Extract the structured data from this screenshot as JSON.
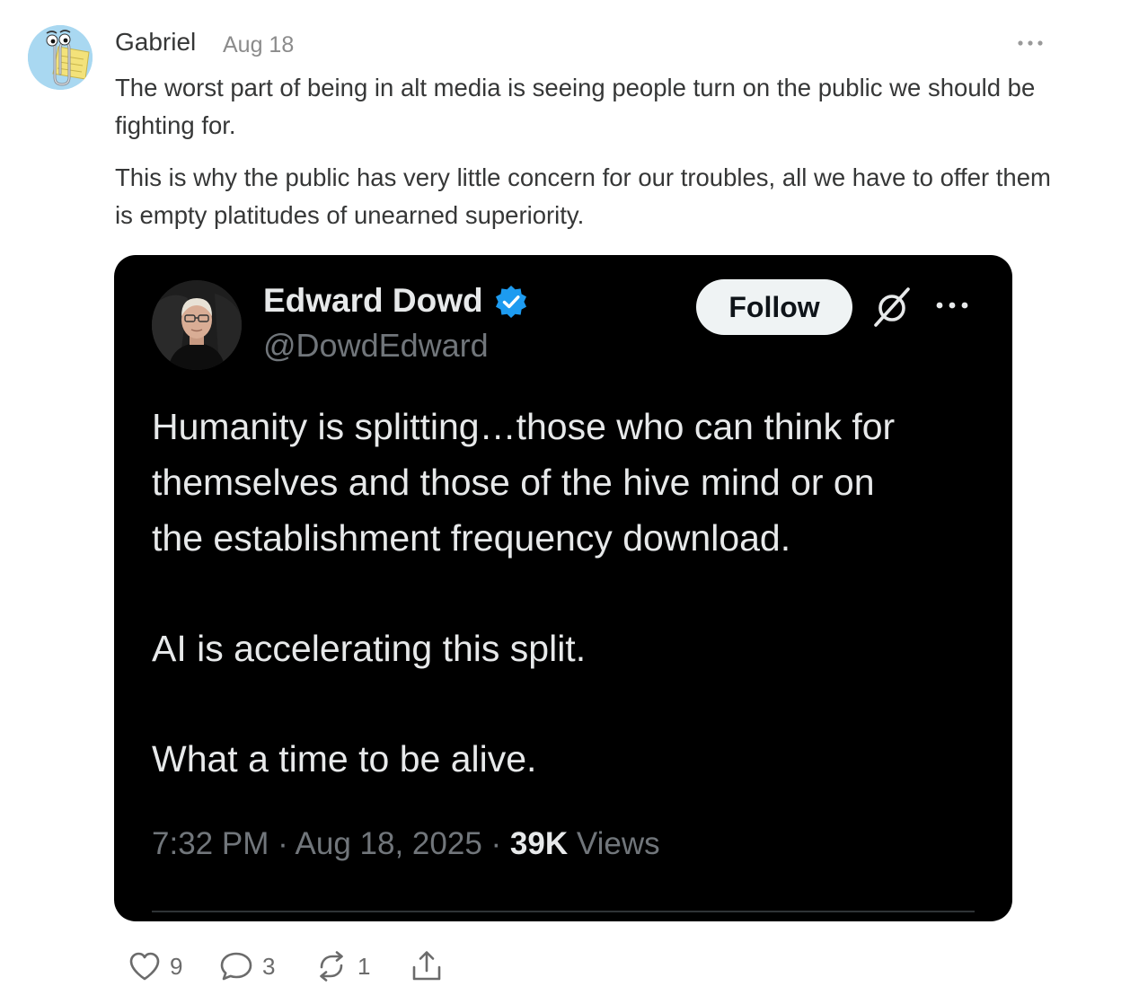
{
  "note": {
    "author": "Gabriel",
    "date": "Aug 18",
    "avatar_icon": "paperclip-assistant-icon",
    "more_icon": "more-horizontal-icon",
    "paragraphs": [
      "The worst part of being in alt media is seeing people turn on the public we should be fighting for.",
      "This is why the public has very little concern for our troubles, all we have to offer them is empty platitudes of unearned superiority."
    ]
  },
  "tweet": {
    "name": "Edward Dowd",
    "handle": "@DowdEdward",
    "verified": true,
    "verified_color": "#1d9bf0",
    "follow_label": "Follow",
    "platform_icon": "x-logo-icon",
    "text_lines": [
      "Humanity is splitting…those who can think for",
      "themselves and those of the hive mind or on",
      "the establishment frequency download.",
      "AI is accelerating this split.",
      "What a time to be alive."
    ],
    "time": "7:32 PM",
    "date": "Aug 18, 2025",
    "views_count": "39K",
    "views_label": "Views"
  },
  "actions": {
    "likes": "9",
    "comments": "3",
    "restacks": "1"
  },
  "colors": {
    "tweet_background": "#000000",
    "tweet_text": "#e7e9ea",
    "tweet_muted": "#71767b",
    "note_text": "#363737"
  }
}
